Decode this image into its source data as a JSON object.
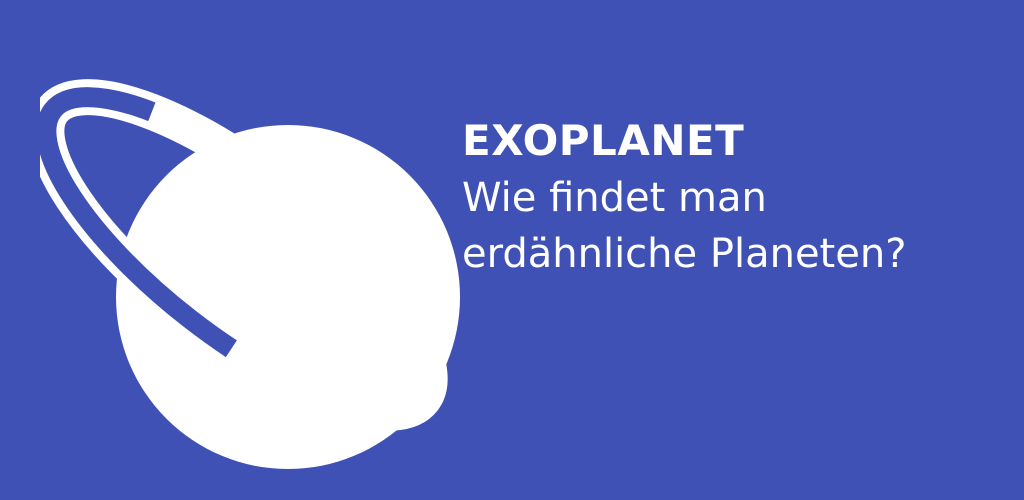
{
  "banner": {
    "background_color": "#3f51b5",
    "foreground_color": "#ffffff",
    "logo_icon": "ringed-planet-icon",
    "title": "EXOPLANET",
    "subtitle_lines": [
      "Wie findet man",
      "erdähnliche Planeten?"
    ]
  }
}
